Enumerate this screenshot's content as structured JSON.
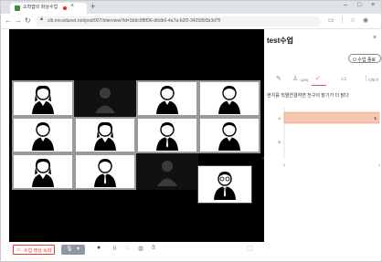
{
  "browser": {
    "tab_title": "소학습의 화상수업",
    "tab_close": "×",
    "new_tab": "+",
    "url": "clb.mo.edunet.net/pod/007/interview?id=3b9c9f8f36-d6db6-4a7a-b2f2-3425893b3d7f/",
    "window_controls": [
      "–",
      "□",
      "×"
    ]
  },
  "participants": {
    "grid": [
      "person-woman",
      "empty-avatar",
      "person-man",
      "person-man",
      "person-man",
      "person-woman",
      "person-man-tie",
      "person-man",
      "person-woman",
      "person-man-tie",
      "empty-avatar",
      "none"
    ],
    "speaker": "person-man-glasses"
  },
  "toolbar": {
    "record_label": "수업 영상 녹화",
    "mic_arrow": "▾"
  },
  "panel": {
    "title": "test수업",
    "close": "×",
    "end_button": "수업 종료",
    "tab_person_label": "(2/0)",
    "tab_more_label": "더보기",
    "quiz_text": "현지를 직렬연결하면 전구의 밝기가 더 밝다"
  },
  "chart_data": {
    "type": "bar",
    "orientation": "horizontal",
    "categories": [
      "A",
      "B"
    ],
    "values": [
      1,
      0
    ],
    "value_labels": [
      "1",
      ""
    ],
    "xlim": [
      0,
      1
    ],
    "ticks": [
      "0",
      "1"
    ],
    "colors": {
      "bar": "#f6c6b0",
      "bar_edge": "#e79070"
    }
  },
  "colors": {
    "accent": "#e8536e",
    "record": "#e83b2e"
  }
}
